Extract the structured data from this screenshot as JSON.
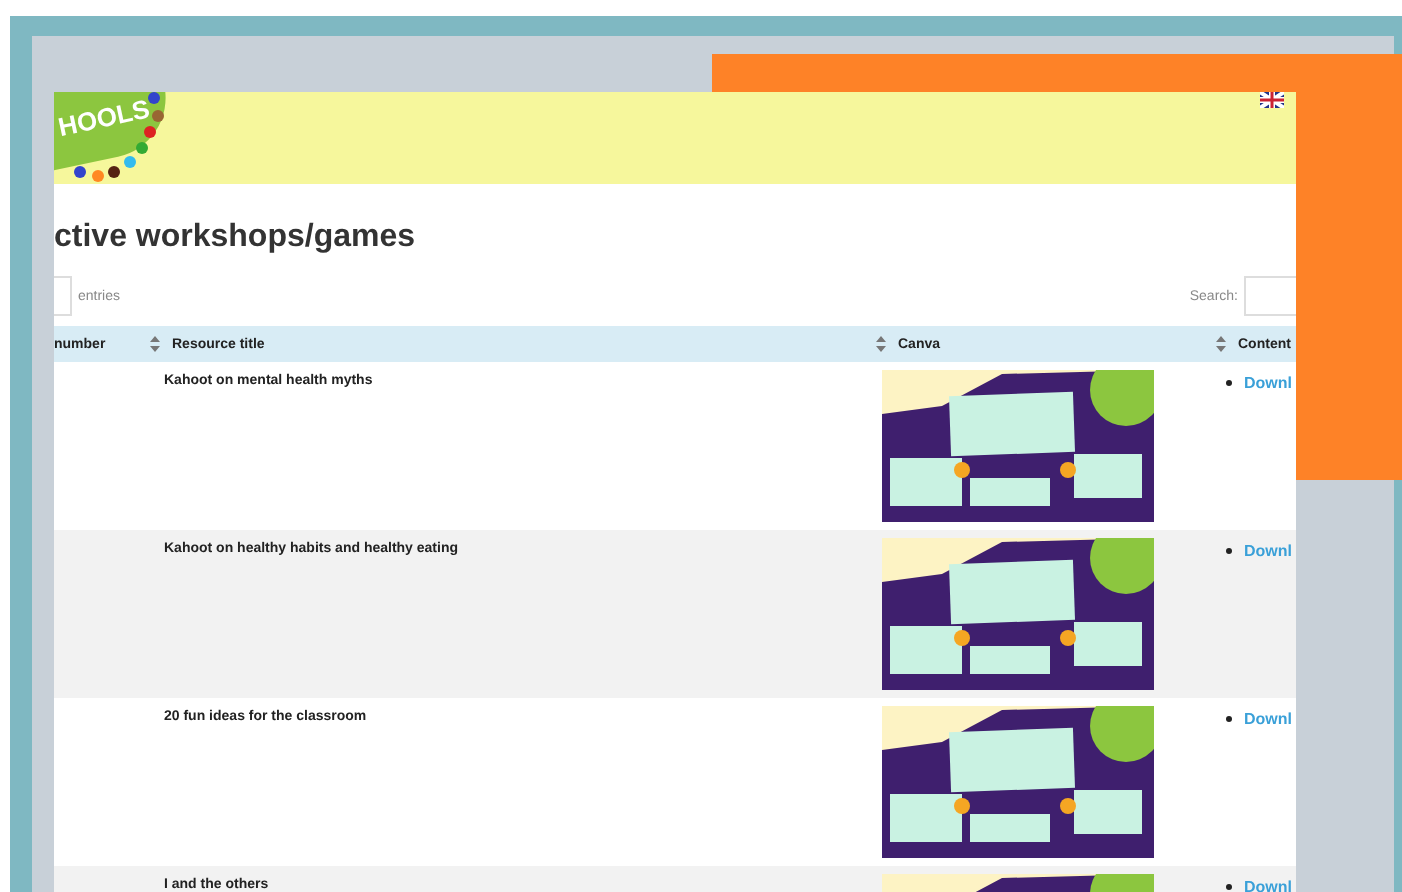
{
  "header": {
    "logo_text": "HOOLS"
  },
  "page_title": "ctive workshops/games",
  "length_control": {
    "label": "entries"
  },
  "search": {
    "label": "Search:"
  },
  "table": {
    "columns": [
      {
        "label": "number"
      },
      {
        "label": "Resource title"
      },
      {
        "label": "Canva"
      },
      {
        "label": "Content"
      }
    ],
    "rows": [
      {
        "title": "Kahoot on mental health myths",
        "link": "Downl"
      },
      {
        "title": "Kahoot on healthy habits and healthy eating",
        "link": "Downl"
      },
      {
        "title": "20 fun ideas for the classroom",
        "link": "Downl"
      },
      {
        "title": "I and the others",
        "link": "Downl"
      }
    ]
  }
}
